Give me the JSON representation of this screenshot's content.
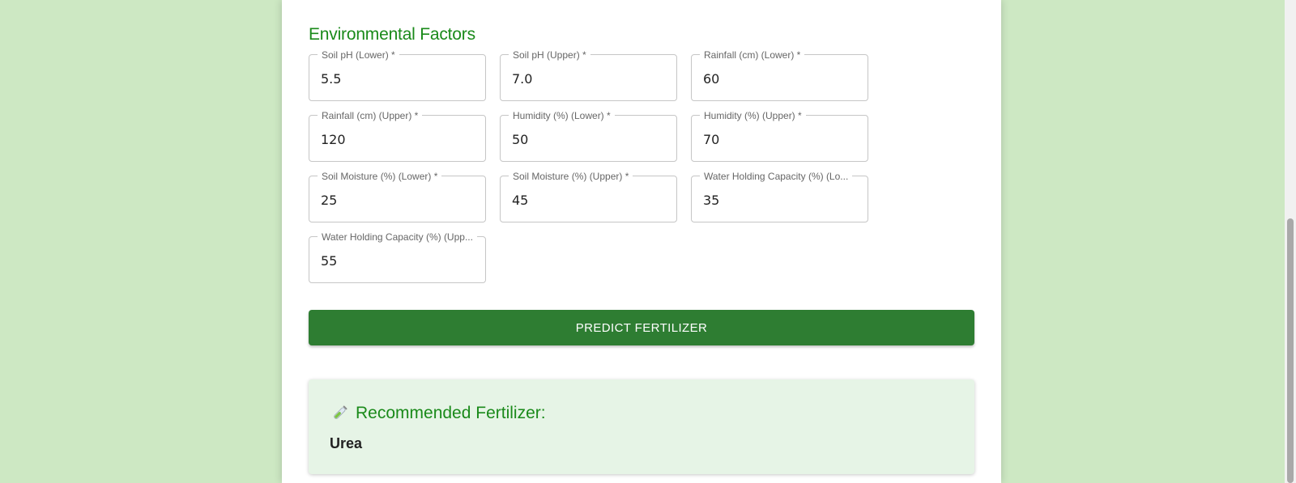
{
  "section": {
    "title": "Environmental Factors"
  },
  "fields": [
    {
      "label": "Soil pH (Lower) *",
      "value": "5.5"
    },
    {
      "label": "Soil pH (Upper) *",
      "value": "7.0"
    },
    {
      "label": "Rainfall (cm) (Lower) *",
      "value": "60"
    },
    {
      "label": "Rainfall (cm) (Upper) *",
      "value": "120"
    },
    {
      "label": "Humidity (%) (Lower) *",
      "value": "50"
    },
    {
      "label": "Humidity (%) (Upper) *",
      "value": "70"
    },
    {
      "label": "Soil Moisture (%) (Lower) *",
      "value": "25"
    },
    {
      "label": "Soil Moisture (%) (Upper) *",
      "value": "45"
    },
    {
      "label": "Water Holding Capacity (%) (Lo...",
      "value": "35"
    },
    {
      "label": "Water Holding Capacity (%) (Upp...",
      "value": "55"
    }
  ],
  "button": {
    "label": "PREDICT FERTILIZER"
  },
  "result": {
    "icon": "test-tube-icon",
    "title": "Recommended Fertilizer:",
    "value": "Urea"
  },
  "colors": {
    "page_background": "#cde8c3",
    "accent": "#1a8a1a",
    "button": "#2e7d32",
    "result_background": "#e6f4e6"
  }
}
